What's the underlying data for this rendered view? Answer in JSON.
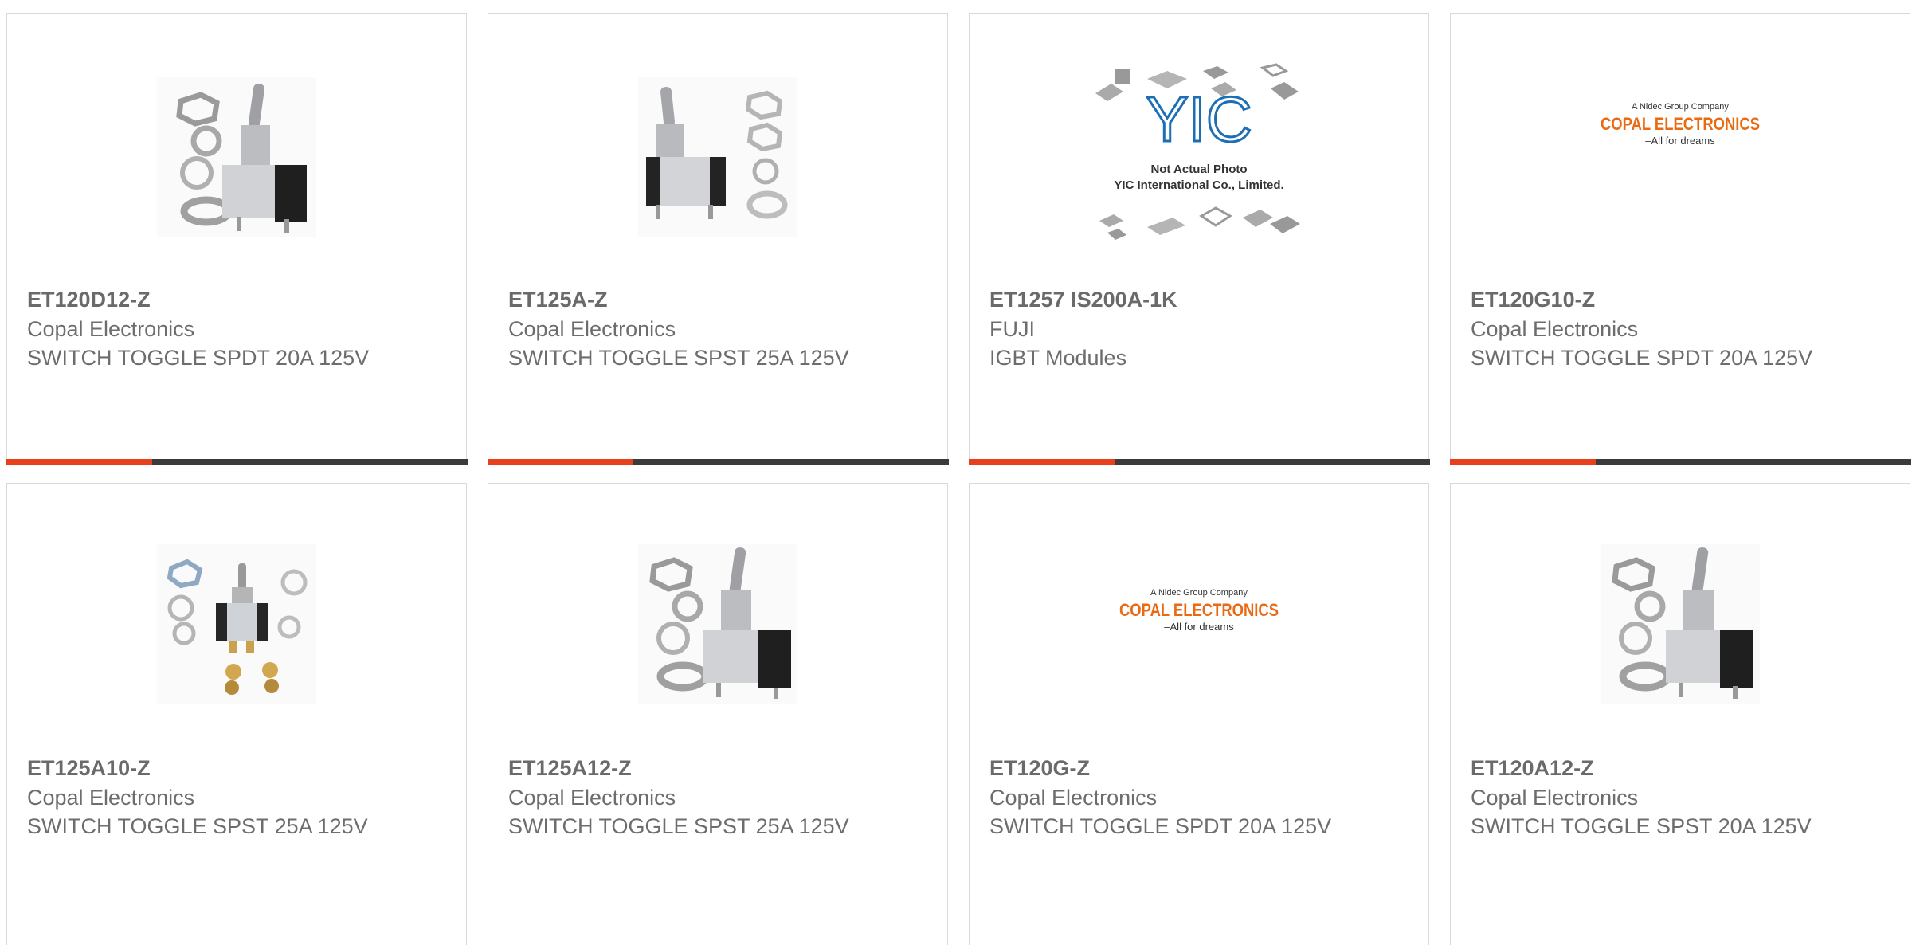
{
  "products": [
    {
      "part_number": "ET120D12-Z",
      "manufacturer": "Copal Electronics",
      "description": "SWITCH TOGGLE SPDT 20A 125V",
      "image": "toggle-switch-kit-photo"
    },
    {
      "part_number": "ET125A-Z",
      "manufacturer": "Copal Electronics",
      "description": "SWITCH TOGGLE SPST 25A 125V",
      "image": "toggle-switch-photo"
    },
    {
      "part_number": "ET1257 IS200A-1K",
      "manufacturer": "FUJI",
      "description": "IGBT Modules",
      "image": "yic-placeholder"
    },
    {
      "part_number": "ET120G10-Z",
      "manufacturer": "Copal Electronics",
      "description": "SWITCH TOGGLE SPDT 20A 125V",
      "image": "copal-logo"
    },
    {
      "part_number": "ET125A10-Z",
      "manufacturer": "Copal Electronics",
      "description": "SWITCH TOGGLE SPST 25A 125V",
      "image": "toggle-switch-hardware-photo"
    },
    {
      "part_number": "ET125A12-Z",
      "manufacturer": "Copal Electronics",
      "description": "SWITCH TOGGLE SPST 25A 125V",
      "image": "toggle-switch-kit-photo"
    },
    {
      "part_number": "ET120G-Z",
      "manufacturer": "Copal Electronics",
      "description": "SWITCH TOGGLE SPDT 20A 125V",
      "image": "copal-logo"
    },
    {
      "part_number": "ET120A12-Z",
      "manufacturer": "Copal Electronics",
      "description": "SWITCH TOGGLE SPST 20A 125V",
      "image": "toggle-switch-kit-photo"
    }
  ],
  "placeholder": {
    "line1": "Not Actual Photo",
    "line2": "YIC International Co., Limited.",
    "logo": "YIC"
  },
  "copal_logo": {
    "tagline_top": "A Nidec Group Company",
    "name": "COPAL ELECTRONICS",
    "slogan": "–All for dreams"
  },
  "colors": {
    "accent": "#e8401c",
    "bar": "#3b3b3b",
    "text": "#6d6d6d",
    "border": "#d9d9d9"
  }
}
